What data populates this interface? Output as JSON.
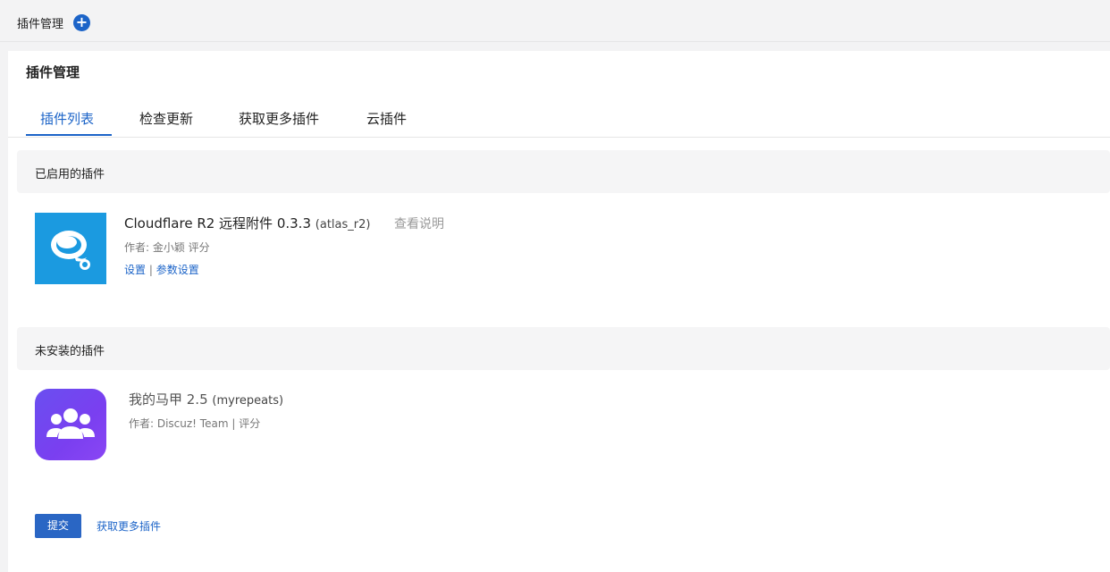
{
  "topbar": {
    "title": "插件管理",
    "add_icon": "plus-icon"
  },
  "panel": {
    "title": "插件管理"
  },
  "tabs": [
    {
      "label": "插件列表",
      "active": true
    },
    {
      "label": "检查更新",
      "active": false
    },
    {
      "label": "获取更多插件",
      "active": false
    },
    {
      "label": "云插件",
      "active": false
    }
  ],
  "sections": {
    "enabled": {
      "title": "已启用的插件",
      "plugin": {
        "name": "Cloudflare R2 远程附件 0.3.3",
        "id": "(atlas_r2)",
        "doc_link": "查看说明",
        "meta": "作者: 金小颖 评分",
        "links": [
          "设置",
          "参数设置"
        ],
        "link_sep": "|",
        "icon": "cloud-chat-icon",
        "icon_color": "#1b9ae0"
      }
    },
    "not_installed": {
      "title": "未安装的插件",
      "plugin": {
        "name": "我的马甲 2.5",
        "id": "(myrepeats)",
        "meta": "作者: Discuz! Team | 评分",
        "icon": "users-group-icon",
        "icon_color": "#6a4ff0"
      }
    }
  },
  "footer": {
    "submit_label": "提交",
    "more_link": "获取更多插件"
  },
  "colors": {
    "accent": "#1c64c8",
    "background": "#f3f3f4"
  }
}
